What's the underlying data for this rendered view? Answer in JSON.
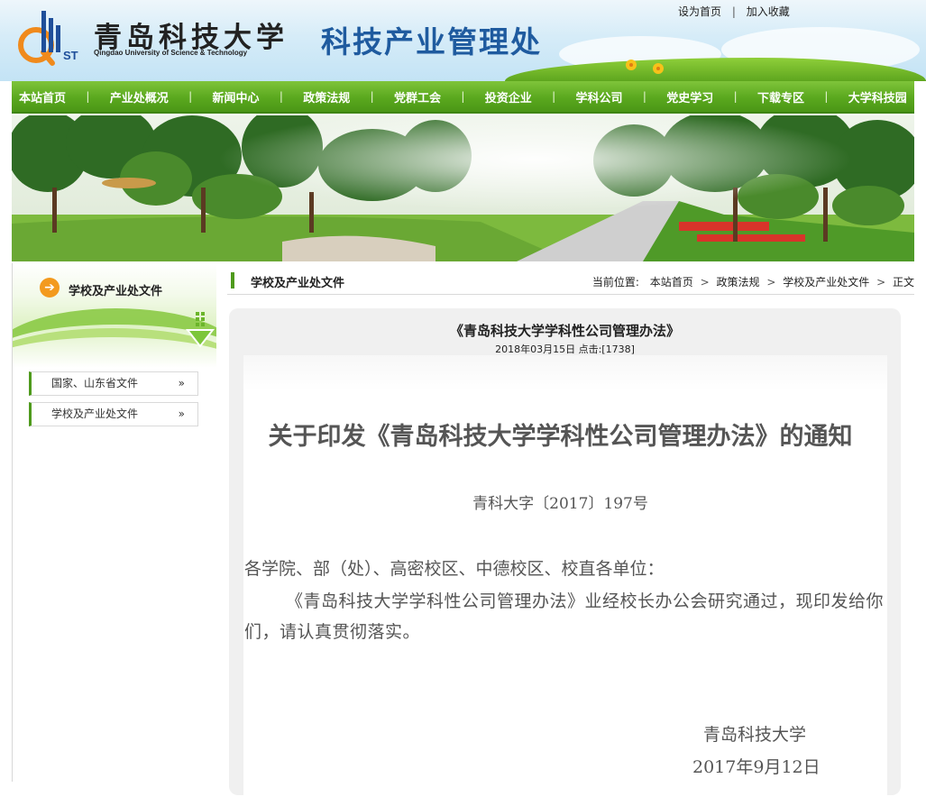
{
  "header": {
    "logo_letters": "QUST",
    "school_name_cn": "青岛科技大学",
    "school_name_en": "Qingdao University of Science & Technology",
    "department": "科技产业管理处",
    "top_links": [
      "设为首页",
      "加入收藏"
    ],
    "top_link_separator": "|"
  },
  "nav": {
    "items": [
      "本站首页",
      "产业处概况",
      "新闻中心",
      "政策法规",
      "党群工会",
      "投资企业",
      "学科公司",
      "党史学习",
      "下载专区",
      "大学科技园"
    ],
    "separator": "|"
  },
  "sidebar": {
    "title": "学校及产业处文件",
    "items": [
      {
        "label": "国家、山东省文件",
        "chevron": "»"
      },
      {
        "label": "学校及产业处文件",
        "chevron": "»"
      }
    ]
  },
  "main": {
    "section_title": "学校及产业处文件",
    "breadcrumb": {
      "prefix": "当前位置:",
      "items": [
        "本站首页",
        "政策法规",
        "学校及产业处文件",
        "正文"
      ],
      "separator": ">"
    },
    "article": {
      "title": "《青岛科技大学学科性公司管理办法》",
      "meta": "2018年03月15日 点击:[1738]",
      "notice_title": "关于印发《青岛科技大学学科性公司管理办法》的通知",
      "notice_number": "青科大字〔2017〕197号",
      "salutation": "各学院、部（处）、高密校区、中德校区、校直各单位：",
      "body": "《青岛科技大学学科性公司管理办法》业经校长办公会研究通过，现印发给你们，请认真贯彻落实。",
      "sign_org": "青岛科技大学",
      "sign_date": "2017年9月12日"
    }
  },
  "colors": {
    "nav_green": "#5aa81e",
    "dept_blue": "#1f5b9f",
    "accent_orange": "#f39a1e",
    "logo_blue": "#1f4f9a"
  }
}
